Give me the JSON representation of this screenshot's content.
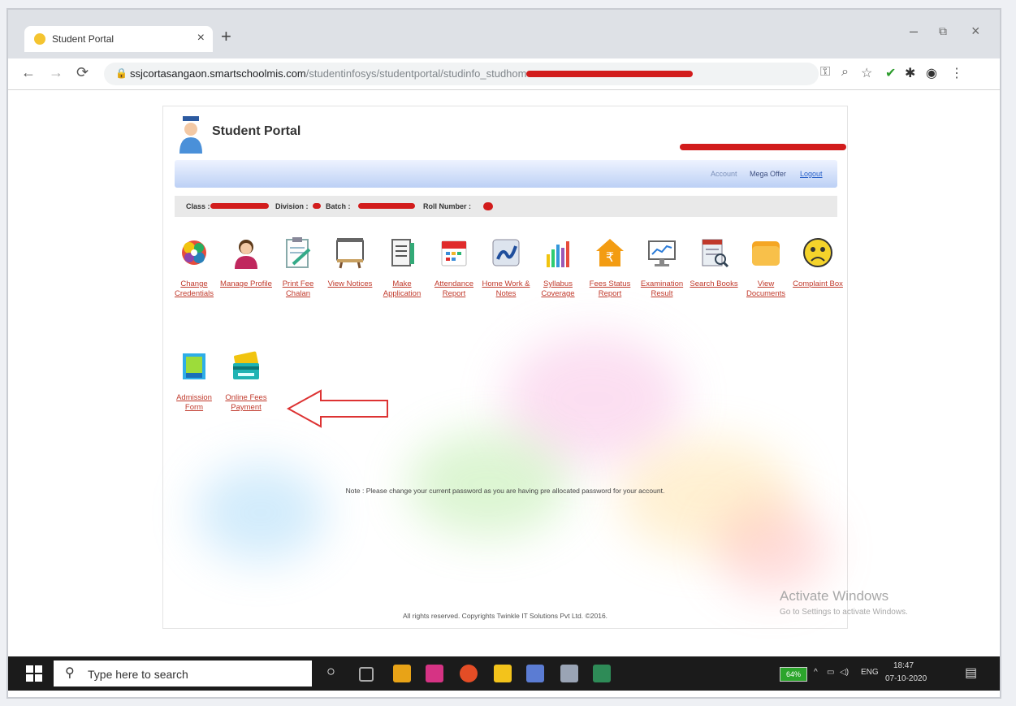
{
  "browser": {
    "tab_title": "Student Portal",
    "tab_close": "×",
    "new_tab": "+",
    "url_host": "ssjcortasangaon.smartschoolmis.com",
    "url_path": "/studentinfosys/studentportal/studinfo_studhome",
    "window_minimize": "–",
    "window_restore": "⧉",
    "window_close": "×"
  },
  "portal": {
    "title": "Student Portal",
    "menu": {
      "account": "Account",
      "mega_offer": "Mega Offer",
      "logout": "Logout"
    },
    "info": {
      "class_label": "Class :",
      "division_label": "Division :",
      "batch_label": "Batch :",
      "roll_label": "Roll Number :"
    },
    "tiles": [
      {
        "label": "Change Credentials",
        "icon": "gears-icon"
      },
      {
        "label": "Manage Profile",
        "icon": "user-icon"
      },
      {
        "label": "Print Fee Chalan",
        "icon": "clipboard-icon"
      },
      {
        "label": "View Notices",
        "icon": "notice-board-icon"
      },
      {
        "label": "Make Application",
        "icon": "document-icon"
      },
      {
        "label": "Attendance Report",
        "icon": "calendar-icon"
      },
      {
        "label": "Home Work & Notes",
        "icon": "pen-notes-icon"
      },
      {
        "label": "Syllabus Coverage",
        "icon": "bar-chart-icon"
      },
      {
        "label": "Fees Status Report",
        "icon": "rupee-house-icon"
      },
      {
        "label": "Examination Result",
        "icon": "monitor-chart-icon"
      },
      {
        "label": "Search Books",
        "icon": "book-search-icon"
      },
      {
        "label": "View Documents",
        "icon": "folder-icon"
      },
      {
        "label": "Complaint Box",
        "icon": "sad-face-icon"
      },
      {
        "label": "Admission Form",
        "icon": "form-icon"
      },
      {
        "label": "Online Fees Payment",
        "icon": "card-payment-icon"
      }
    ],
    "note": "Note : Please change your current password as you are having pre allocated password for your account.",
    "footer": "All rights reserved. Copyrights Twinkle IT Solutions Pvt Ltd. ©2016."
  },
  "watermark": {
    "line1": "Activate Windows",
    "line2": "Go to Settings to activate Windows."
  },
  "taskbar": {
    "search_placeholder": "Type here to search",
    "battery": "64%",
    "lang": "ENG",
    "time": "18:47",
    "date": "07-10-2020"
  },
  "colors": {
    "link_red": "#c0392b",
    "menubar_blue": "#bcd0f5",
    "redaction": "#d21c1c",
    "taskbar": "#1b1b1b"
  }
}
